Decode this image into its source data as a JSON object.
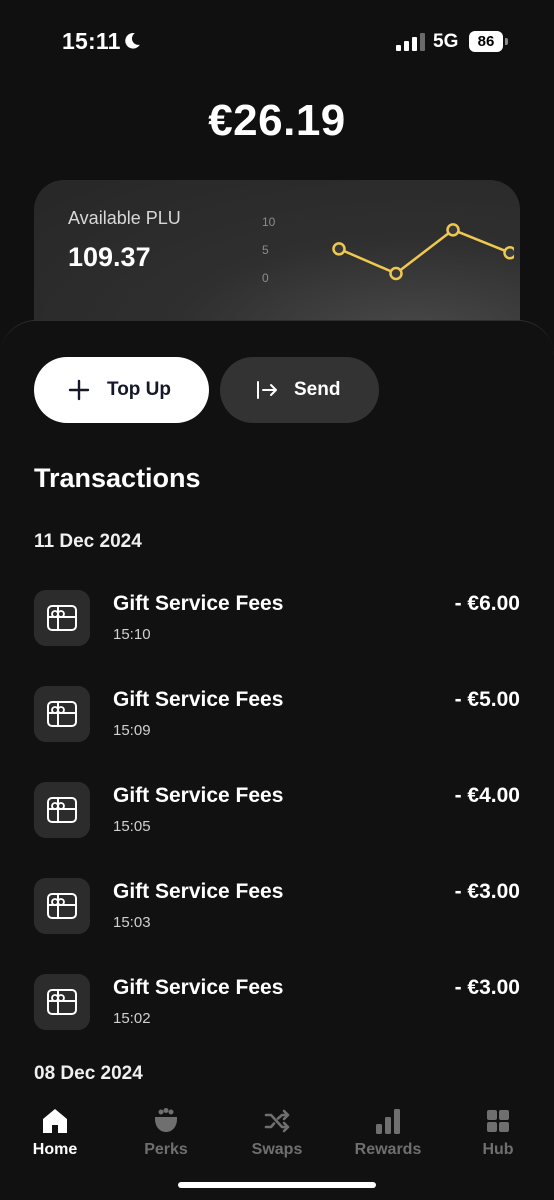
{
  "status_bar": {
    "time": "15:11",
    "network": "5G",
    "battery": "86"
  },
  "balance": "€26.19",
  "plu_card": {
    "label": "Available PLU",
    "value": "109.37",
    "chart_data": {
      "type": "line",
      "y_ticks": [
        "10",
        "5",
        "0"
      ],
      "ylim": [
        0,
        10
      ],
      "values": [
        5.2,
        0.8,
        8.6,
        4.5
      ],
      "color": "#f0c850"
    }
  },
  "actions": {
    "topup_label": "Top Up",
    "send_label": "Send"
  },
  "transactions_title": "Transactions",
  "groups": [
    {
      "date": "11 Dec 2024",
      "items": [
        {
          "title": "Gift Service Fees",
          "time": "15:10",
          "amount": "- €6.00"
        },
        {
          "title": "Gift Service Fees",
          "time": "15:09",
          "amount": "- €5.00"
        },
        {
          "title": "Gift Service Fees",
          "time": "15:05",
          "amount": "- €4.00"
        },
        {
          "title": "Gift Service Fees",
          "time": "15:03",
          "amount": "- €3.00"
        },
        {
          "title": "Gift Service Fees",
          "time": "15:02",
          "amount": "- €3.00"
        }
      ]
    },
    {
      "date": "08 Dec 2024",
      "items": []
    }
  ],
  "nav": [
    {
      "label": "Home",
      "icon": "home-icon",
      "active": true
    },
    {
      "label": "Perks",
      "icon": "pot-icon",
      "active": false
    },
    {
      "label": "Swaps",
      "icon": "shuffle-icon",
      "active": false
    },
    {
      "label": "Rewards",
      "icon": "bar-chart-icon",
      "active": false
    },
    {
      "label": "Hub",
      "icon": "grid-icon",
      "active": false
    }
  ],
  "colors": {
    "background": "#101010",
    "card": "#2f2f2f",
    "accent_line": "#f0c850",
    "inactive_nav": "#6f6f6f"
  }
}
